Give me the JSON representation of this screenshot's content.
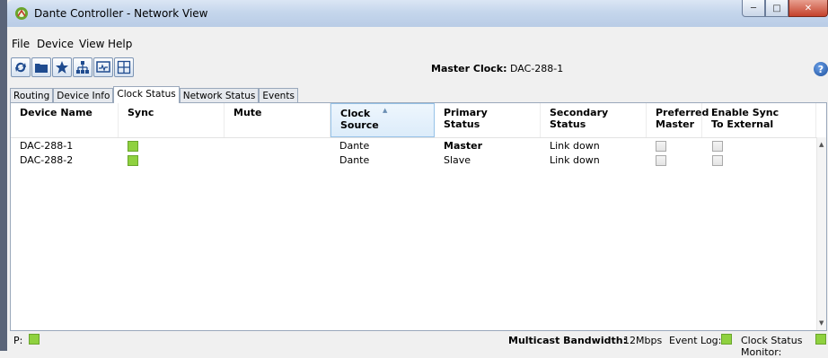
{
  "window": {
    "title": "Dante Controller - Network View"
  },
  "menu": [
    "File",
    "Device",
    "View",
    "Help"
  ],
  "toolbar": {
    "master_clock_label": "Master Clock:",
    "master_clock_value": "DAC-288-1",
    "buttons": [
      "refresh-icon",
      "folder-icon",
      "star-icon",
      "network-icon",
      "monitor-icon",
      "grid-plus-icon"
    ]
  },
  "tabs": [
    {
      "label": "Routing",
      "active": false
    },
    {
      "label": "Device Info",
      "active": false
    },
    {
      "label": "Clock Status",
      "active": true
    },
    {
      "label": "Network Status",
      "active": false
    },
    {
      "label": "Events",
      "active": false
    }
  ],
  "table": {
    "headers": {
      "device_name": "Device Name",
      "sync": "Sync",
      "mute": "Mute",
      "clock_source": "Clock Source",
      "primary_status": "Primary Status",
      "secondary_status": "Secondary Status",
      "preferred_master": "Preferred Master",
      "enable_sync": "Enable Sync To External"
    },
    "rows": [
      {
        "device": "DAC-288-1",
        "sync": "ok",
        "clock_source": "Dante",
        "primary_status": "Master",
        "secondary_status": "Link down",
        "preferred_master": false,
        "enable_sync": false
      },
      {
        "device": "DAC-288-2",
        "sync": "ok",
        "clock_source": "Dante",
        "primary_status": "Slave",
        "secondary_status": "Link down",
        "preferred_master": false,
        "enable_sync": false
      }
    ]
  },
  "status": {
    "p_label": "P:",
    "bandwidth_label": "Multicast Bandwidth:",
    "bandwidth_value": "12Mbps",
    "event_log_label": "Event Log:",
    "clock_monitor_label": "Clock Status Monitor:"
  },
  "colors": {
    "led_green": "#8fd13f",
    "sorted_header": "#dcecfa"
  }
}
